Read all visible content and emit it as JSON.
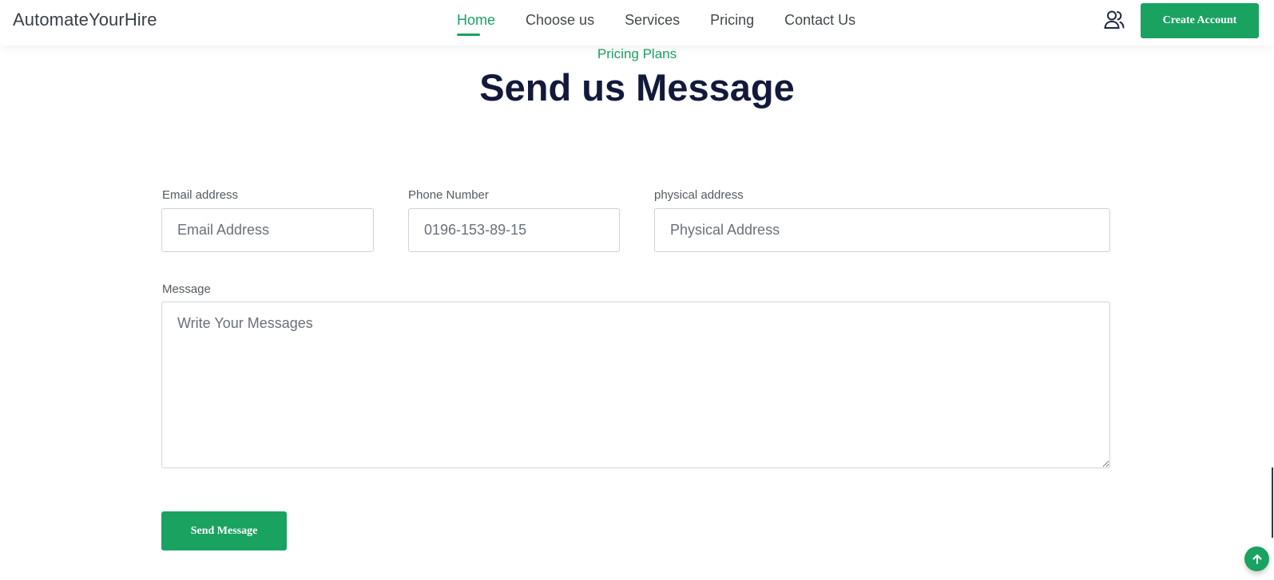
{
  "brand": {
    "name": "AutomateYourHire"
  },
  "nav": {
    "items": [
      {
        "label": "Home",
        "active": true
      },
      {
        "label": "Choose us",
        "active": false
      },
      {
        "label": "Services",
        "active": false
      },
      {
        "label": "Pricing",
        "active": false
      },
      {
        "label": "Contact Us",
        "active": false
      }
    ]
  },
  "header_actions": {
    "user_icon": "users-icon",
    "create_account_label": "Create Account"
  },
  "section": {
    "eyebrow": "Pricing Plans",
    "title": "Send us Message"
  },
  "form": {
    "email": {
      "label": "Email address",
      "placeholder": "Email Address",
      "value": ""
    },
    "phone": {
      "label": "Phone Number",
      "placeholder": "0196-153-89-15",
      "value": ""
    },
    "address": {
      "label": "physical address",
      "placeholder": "Physical Address",
      "value": ""
    },
    "message": {
      "label": "Message",
      "placeholder": "Write Your Messages",
      "value": ""
    },
    "submit_label": "Send Message"
  },
  "scroll_top": {
    "icon": "arrow-up-icon"
  },
  "colors": {
    "accent": "#1aa260",
    "heading": "#13193a",
    "text": "#43474c",
    "border": "#cfd2d6"
  }
}
